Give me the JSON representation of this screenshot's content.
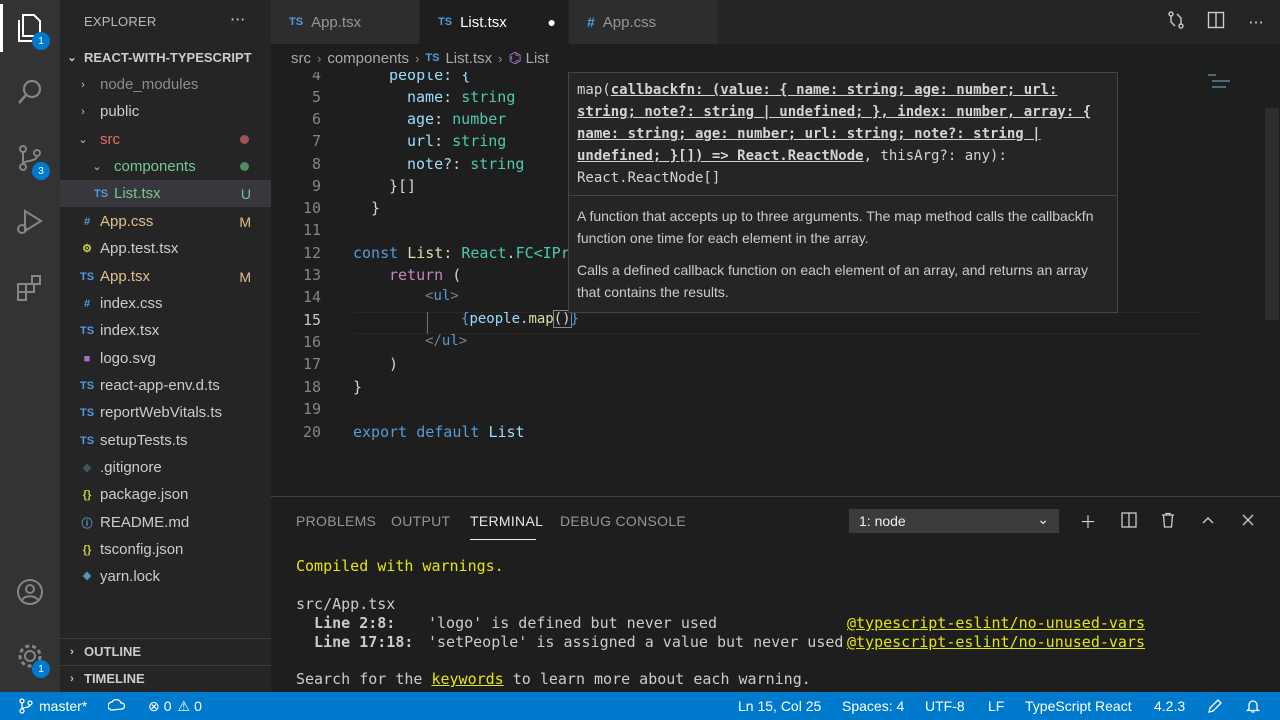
{
  "explorer": {
    "title": "EXPLORER",
    "more": "···",
    "project": "REACT-WITH-TYPESCRIPT",
    "items": [
      {
        "label": "node_modules",
        "icon": "chevron-right-icon",
        "color": "#8c8c8c"
      },
      {
        "label": "public",
        "icon": "chevron-right-icon",
        "color": "#cccccc"
      },
      {
        "label": "src",
        "icon": "chevron-down-icon",
        "color": "#e2726d"
      },
      {
        "label": "components",
        "icon": "chevron-down-icon",
        "color": "#73c991"
      },
      {
        "label": "List.tsx",
        "icon": "ts-file-icon",
        "deco": "U",
        "color": "#73c991"
      },
      {
        "label": "App.css",
        "icon": "css-file-icon",
        "deco": "M",
        "color": "#e2c08d"
      },
      {
        "label": "App.test.tsx",
        "icon": "test-file-icon",
        "color": "#cccccc"
      },
      {
        "label": "App.tsx",
        "icon": "ts-file-icon",
        "deco": "M",
        "color": "#e2c08d"
      },
      {
        "label": "index.css",
        "icon": "css-file-icon",
        "color": "#cccccc"
      },
      {
        "label": "index.tsx",
        "icon": "ts-file-icon",
        "color": "#cccccc"
      },
      {
        "label": "logo.svg",
        "icon": "svg-file-icon",
        "color": "#cccccc"
      },
      {
        "label": "react-app-env.d.ts",
        "icon": "ts-file-icon",
        "color": "#cccccc"
      },
      {
        "label": "reportWebVitals.ts",
        "icon": "ts-file-icon",
        "color": "#cccccc"
      },
      {
        "label": "setupTests.ts",
        "icon": "ts-file-icon",
        "color": "#cccccc"
      },
      {
        "label": ".gitignore",
        "icon": "git-file-icon",
        "color": "#cccccc"
      },
      {
        "label": "package.json",
        "icon": "json-file-icon",
        "color": "#cccccc"
      },
      {
        "label": "README.md",
        "icon": "info-file-icon",
        "color": "#cccccc"
      },
      {
        "label": "tsconfig.json",
        "icon": "json-file-icon",
        "color": "#cccccc"
      },
      {
        "label": "yarn.lock",
        "icon": "yarn-file-icon",
        "color": "#cccccc"
      }
    ],
    "outline": "OUTLINE",
    "timeline": "TIMELINE"
  },
  "activity": {
    "explorer_badge": "1",
    "scm_badge": "3",
    "settings_badge": "1"
  },
  "tabs": [
    {
      "prefix": "TS",
      "label": "App.tsx"
    },
    {
      "prefix": "TS",
      "label": "List.tsx",
      "dirty": "●"
    },
    {
      "prefix": "#",
      "label": "App.css"
    }
  ],
  "breadcrumb": {
    "parts": [
      "src",
      "components",
      "List.tsx",
      "List"
    ],
    "file_prefix": "TS",
    "symbol_icon": "⌬"
  },
  "editor": {
    "line_numbers": [
      "4",
      "5",
      "6",
      "7",
      "8",
      "9",
      "10",
      "11",
      "12",
      "13",
      "14",
      "15",
      "16",
      "17",
      "18",
      "19",
      "20"
    ],
    "current_line": "15",
    "lines": {
      "l4": "people: {",
      "l5a": "name",
      "l5b": ": ",
      "l5c": "string",
      "l6a": "age",
      "l6b": ": ",
      "l6c": "number",
      "l7a": "url",
      "l7b": ": ",
      "l7c": "string",
      "l8a": "note?",
      "l8b": ": ",
      "l8c": "string",
      "l9": "}[]",
      "l10": "}",
      "l12a": "const",
      "l12b": "List",
      "l12c": ": ",
      "l12d": "React",
      "l12e": ".",
      "l12f": "FC",
      "l12g": "<IPr",
      "l13a": "return",
      "l13b": " (",
      "l14a": "<",
      "l14b": "ul",
      "l14c": ">",
      "l15a": "{",
      "l15b": "people",
      "l15c": ".",
      "l15d": "map",
      "l15e": "()",
      "l15f": "}",
      "l16a": "</",
      "l16b": "ul",
      "l16c": ">",
      "l17": ")",
      "l18": "}",
      "l20a": "export",
      "l20b": "default",
      "l20c": "List"
    }
  },
  "hover": {
    "sig_fn": "map(",
    "sig_param": "callbackfn: (value: { name: string; age: number; url: string; note?: string | undefined; }, index: number, array: { name: string; age: number; url: string; note?: string | undefined; }[]) => React.ReactNode",
    "sig_rest": ", thisArg?: any):",
    "sig_return": "React.ReactNode[]",
    "doc1": "A function that accepts up to three arguments. The map method calls the callbackfn function one time for each element in the array.",
    "doc2": "Calls a defined callback function on each element of an array, and returns an array that contains the results."
  },
  "panel": {
    "tabs": [
      "PROBLEMS",
      "OUTPUT",
      "TERMINAL",
      "DEBUG CONSOLE"
    ],
    "active_tab": "TERMINAL",
    "terminal_select": "1: node",
    "terminal": {
      "compiled": "Compiled with warnings.",
      "file": "src/App.tsx",
      "w1_loc": "  Line 2:8:",
      "w1_msg": "'logo' is defined but never used",
      "w1_rule": "@typescript-eslint/no-unused-vars",
      "w2_loc": "  Line 17:18:",
      "w2_msg": "'setPeople' is assigned a value but never used",
      "w2_rule": "@typescript-eslint/no-unused-vars",
      "search_pre": "Search for the ",
      "search_kw": "keywords",
      "search_post": " to learn more about each warning."
    }
  },
  "status": {
    "branch": "master*",
    "errors": "0",
    "warnings": "0",
    "position": "Ln 15, Col 25",
    "spaces": "Spaces: 4",
    "encoding": "UTF-8",
    "eol": "LF",
    "language": "TypeScript React",
    "version": "4.2.3"
  },
  "colors": {
    "accent": "#007acc",
    "modified": "#e2c08d",
    "untracked": "#73c991",
    "error": "#e2726d"
  }
}
